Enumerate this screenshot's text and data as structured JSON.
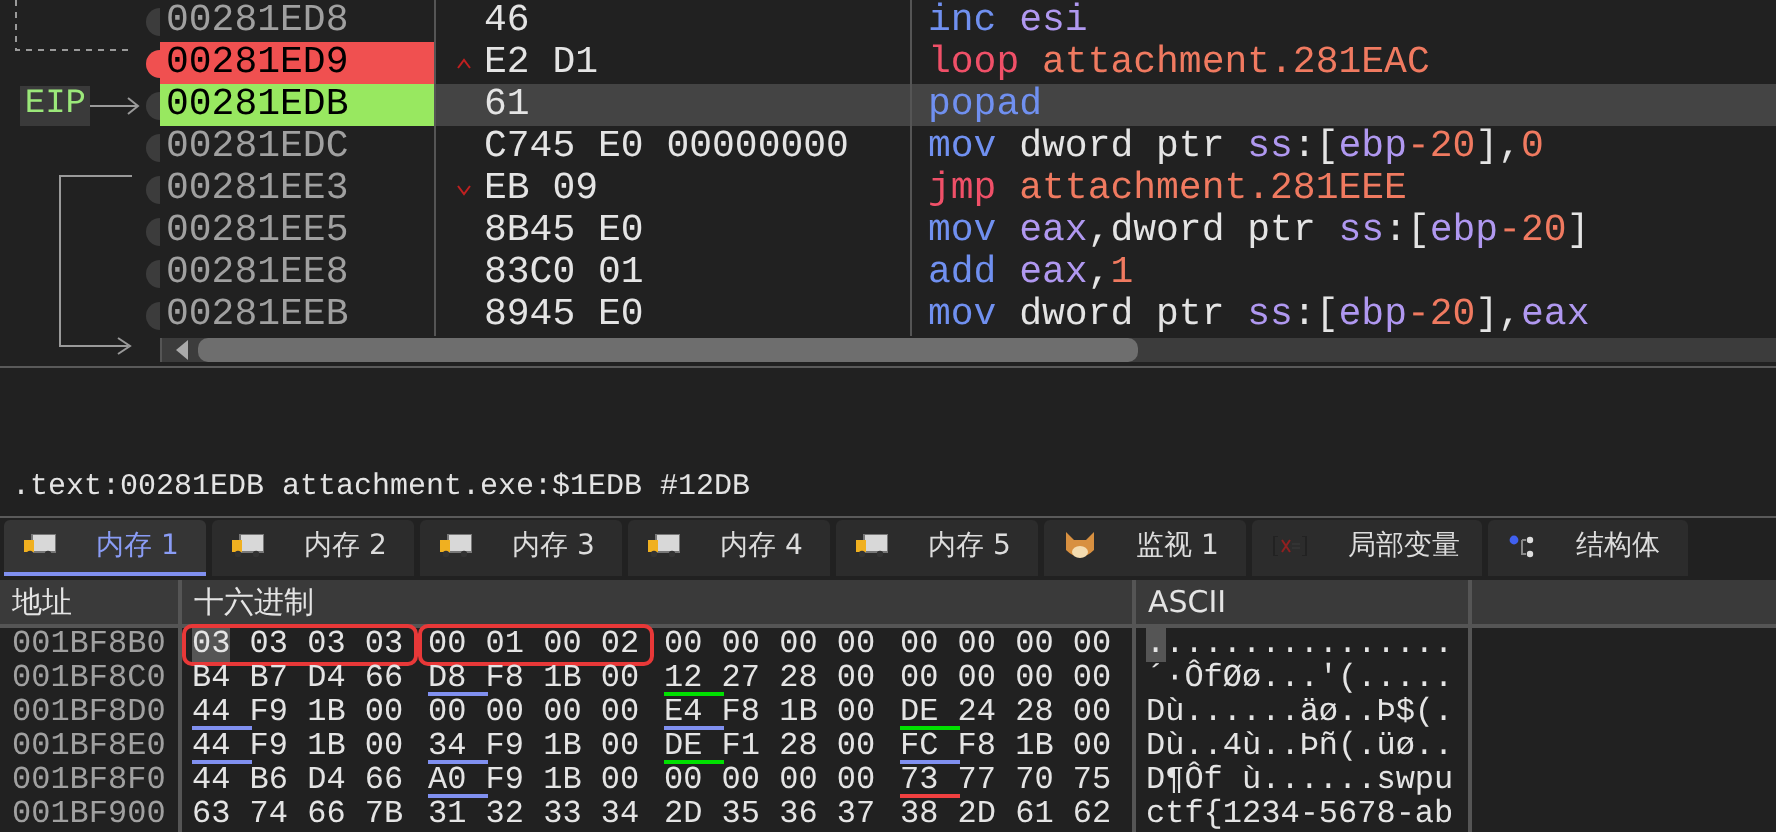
{
  "disassembly": {
    "eip_label": "EIP",
    "rows": [
      {
        "address": "00281ED8",
        "bytes": "46",
        "breakpoint": false,
        "current": false,
        "selected": false,
        "instruction": [
          {
            "text": "inc ",
            "kind": "mnemonic"
          },
          {
            "text": "esi",
            "kind": "register"
          }
        ]
      },
      {
        "address": "00281ED9",
        "bytes": "E2 D1",
        "breakpoint": true,
        "current": false,
        "selected": false,
        "jump": {
          "kind": "up"
        },
        "instruction": [
          {
            "text": "loop ",
            "kind": "jump"
          },
          {
            "text": "attachment.281EAC",
            "kind": "number"
          }
        ]
      },
      {
        "address": "00281EDB",
        "bytes": "61",
        "breakpoint": false,
        "current": true,
        "selected": true,
        "instruction": [
          {
            "text": "popad",
            "kind": "mnemonic"
          }
        ]
      },
      {
        "address": "00281EDC",
        "bytes": "C745 E0 00000000",
        "breakpoint": false,
        "current": false,
        "selected": false,
        "instruction": [
          {
            "text": "mov",
            "kind": "mnemonic"
          },
          {
            "text": " dword ptr ",
            "kind": "text"
          },
          {
            "text": "ss",
            "kind": "register"
          },
          {
            "text": ":[",
            "kind": "text"
          },
          {
            "text": "ebp",
            "kind": "register"
          },
          {
            "text": "-20",
            "kind": "number"
          },
          {
            "text": "],",
            "kind": "text"
          },
          {
            "text": "0",
            "kind": "number"
          }
        ]
      },
      {
        "address": "00281EE3",
        "bytes": "EB 09",
        "breakpoint": false,
        "current": false,
        "selected": false,
        "jump": {
          "kind": "down"
        },
        "instruction": [
          {
            "text": "jmp ",
            "kind": "jump"
          },
          {
            "text": "attachment.281EEE",
            "kind": "number"
          }
        ]
      },
      {
        "address": "00281EE5",
        "bytes": "8B45 E0",
        "breakpoint": false,
        "current": false,
        "selected": false,
        "instruction": [
          {
            "text": "mov ",
            "kind": "mnemonic"
          },
          {
            "text": "eax",
            "kind": "register"
          },
          {
            "text": ",dword ptr ",
            "kind": "text"
          },
          {
            "text": "ss",
            "kind": "register"
          },
          {
            "text": ":[",
            "kind": "text"
          },
          {
            "text": "ebp",
            "kind": "register"
          },
          {
            "text": "-20",
            "kind": "number"
          },
          {
            "text": "]",
            "kind": "text"
          }
        ]
      },
      {
        "address": "00281EE8",
        "bytes": "83C0 01",
        "breakpoint": false,
        "current": false,
        "selected": false,
        "instruction": [
          {
            "text": "add ",
            "kind": "mnemonic"
          },
          {
            "text": "eax",
            "kind": "register"
          },
          {
            "text": ",",
            "kind": "text"
          },
          {
            "text": "1",
            "kind": "number"
          }
        ]
      },
      {
        "address": "00281EEB",
        "bytes": "8945 E0",
        "breakpoint": false,
        "current": false,
        "selected": false,
        "instruction": [
          {
            "text": "mov",
            "kind": "mnemonic"
          },
          {
            "text": " dword ptr ",
            "kind": "text"
          },
          {
            "text": "ss",
            "kind": "register"
          },
          {
            "text": ":[",
            "kind": "text"
          },
          {
            "text": "ebp",
            "kind": "register"
          },
          {
            "text": "-20",
            "kind": "number"
          },
          {
            "text": "],",
            "kind": "text"
          },
          {
            "text": "eax",
            "kind": "register"
          }
        ]
      }
    ]
  },
  "info_line": ".text:00281EDB attachment.exe:$1EDB #12DB",
  "tabs": [
    {
      "label": "内存 1",
      "kind": "memory",
      "selected": true
    },
    {
      "label": "内存 2",
      "kind": "memory",
      "selected": false
    },
    {
      "label": "内存 3",
      "kind": "memory",
      "selected": false
    },
    {
      "label": "内存 4",
      "kind": "memory",
      "selected": false
    },
    {
      "label": "内存 5",
      "kind": "memory",
      "selected": false
    },
    {
      "label": "监视 1",
      "kind": "watch",
      "selected": false
    },
    {
      "label": "局部变量",
      "kind": "locals",
      "selected": false
    },
    {
      "label": "结构体",
      "kind": "struct",
      "selected": false
    }
  ],
  "memory": {
    "columns": [
      "地址",
      "十六进制",
      "ASCII"
    ],
    "rows": [
      {
        "address": "001BF8B0",
        "cursor": true,
        "ascii": "................",
        "groups": [
          {
            "bytes": "03 03 03 03",
            "boxed": true
          },
          {
            "bytes": "00 01 00 02",
            "boxed": true
          },
          {
            "bytes": "00 00 00 00",
            "boxed": false
          },
          {
            "bytes": "00 00 00 00",
            "boxed": false
          }
        ]
      },
      {
        "address": "001BF8C0",
        "cursor": false,
        "ascii": "´·ÔfØø...'(.....",
        "groups": [
          {
            "bytes": "B4 B7 D4 66",
            "boxed": false
          },
          {
            "bytes": "D8 F8 1B 00",
            "boxed": false,
            "color": "#8090f0"
          },
          {
            "bytes": "12 27 28 00",
            "boxed": false,
            "color": "#00e000"
          },
          {
            "bytes": "00 00 00 00",
            "boxed": false
          }
        ]
      },
      {
        "address": "001BF8D0",
        "cursor": false,
        "ascii": "Dù......äø..Þ$(.",
        "groups": [
          {
            "bytes": "44 F9 1B 00",
            "boxed": false,
            "color": "#8090f0"
          },
          {
            "bytes": "00 00 00 00",
            "boxed": false
          },
          {
            "bytes": "E4 F8 1B 00",
            "boxed": false,
            "color": "#8090f0"
          },
          {
            "bytes": "DE 24 28 00",
            "boxed": false,
            "color": "#00e000"
          }
        ]
      },
      {
        "address": "001BF8E0",
        "cursor": false,
        "ascii": "Dù..4ù..Þñ(.üø..",
        "groups": [
          {
            "bytes": "44 F9 1B 00",
            "boxed": false,
            "color": "#8090f0"
          },
          {
            "bytes": "34 F9 1B 00",
            "boxed": false,
            "color": "#8090f0"
          },
          {
            "bytes": "DE F1 28 00",
            "boxed": false,
            "color": "#00e000"
          },
          {
            "bytes": "FC F8 1B 00",
            "boxed": false,
            "color": "#8090f0"
          }
        ]
      },
      {
        "address": "001BF8F0",
        "cursor": false,
        "ascii": "D¶Ôf ù......swpu",
        "groups": [
          {
            "bytes": "44 B6 D4 66",
            "boxed": false
          },
          {
            "bytes": "A0 F9 1B 00",
            "boxed": false,
            "color": "#8090f0"
          },
          {
            "bytes": "00 00 00 00",
            "boxed": false
          },
          {
            "bytes": "73 77 70 75",
            "boxed": false,
            "color": "#f04040"
          }
        ]
      },
      {
        "address": "001BF900",
        "cursor": false,
        "ascii": "ctf{1234-5678-ab",
        "groups": [
          {
            "bytes": "63 74 66 7B",
            "boxed": false
          },
          {
            "bytes": "31 32 33 34",
            "boxed": false
          },
          {
            "bytes": "2D 35 36 37",
            "boxed": false
          },
          {
            "bytes": "38 2D 61 62",
            "boxed": false
          }
        ]
      }
    ]
  }
}
